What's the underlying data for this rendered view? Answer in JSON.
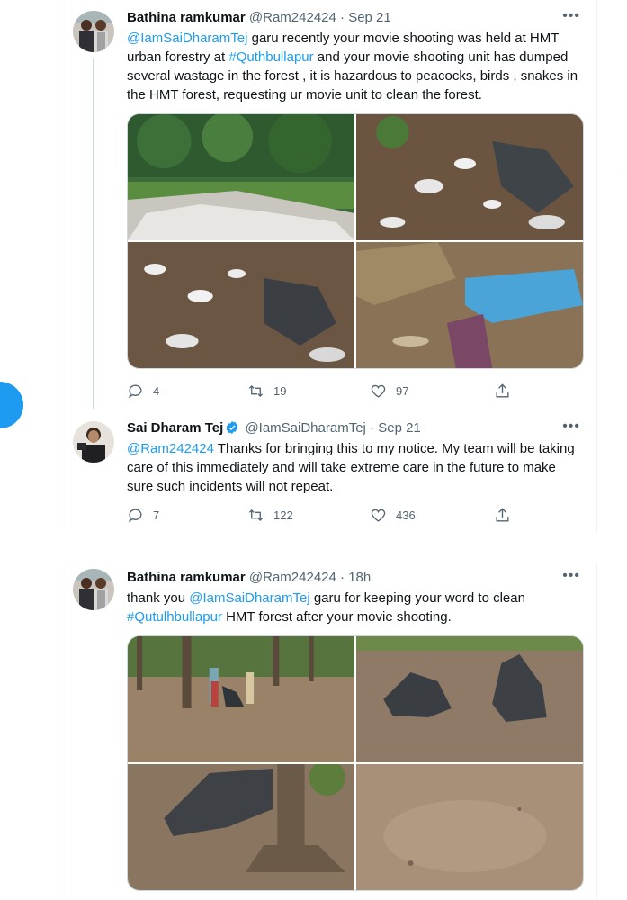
{
  "tweet1": {
    "name": "Bathina ramkumar",
    "handle": "@Ram242424",
    "sep": "·",
    "time": "Sep 21",
    "mention": "@IamSaiDharamTej",
    "text_a": " garu recently your movie shooting was held at HMT urban forestry at ",
    "hashtag": "#Quthbullapur",
    "text_b": " and your movie shooting unit has dumped several wastage in the forest , it is hazardous to peacocks, birds , snakes in the HMT forest, requesting ur movie unit to clean the forest.",
    "replies": "4",
    "retweets": "19",
    "likes": "97"
  },
  "tweet2": {
    "name": "Sai Dharam Tej",
    "handle": "@IamSaiDharamTej",
    "sep": "·",
    "time": "Sep 21",
    "mention": "@Ram242424",
    "text": " Thanks for bringing this to my notice. My team will be taking care of this immediately and will take extreme care in the future to make sure such incidents will not repeat.",
    "replies": "7",
    "retweets": "122",
    "likes": "436"
  },
  "tweet3": {
    "name": "Bathina ramkumar",
    "handle": "@Ram242424",
    "sep": "·",
    "time": "18h",
    "text_a": "thank you ",
    "mention": "@IamSaiDharamTej",
    "text_b": " garu for keeping your word to clean ",
    "hashtag": "#Qutulhbullapur",
    "text_c": " HMT forest after your movie shooting."
  },
  "more_label": "•••",
  "colors": {
    "accent": "#1d9bf0",
    "muted": "#536471",
    "text": "#0f1419",
    "border": "#cfd9de"
  }
}
